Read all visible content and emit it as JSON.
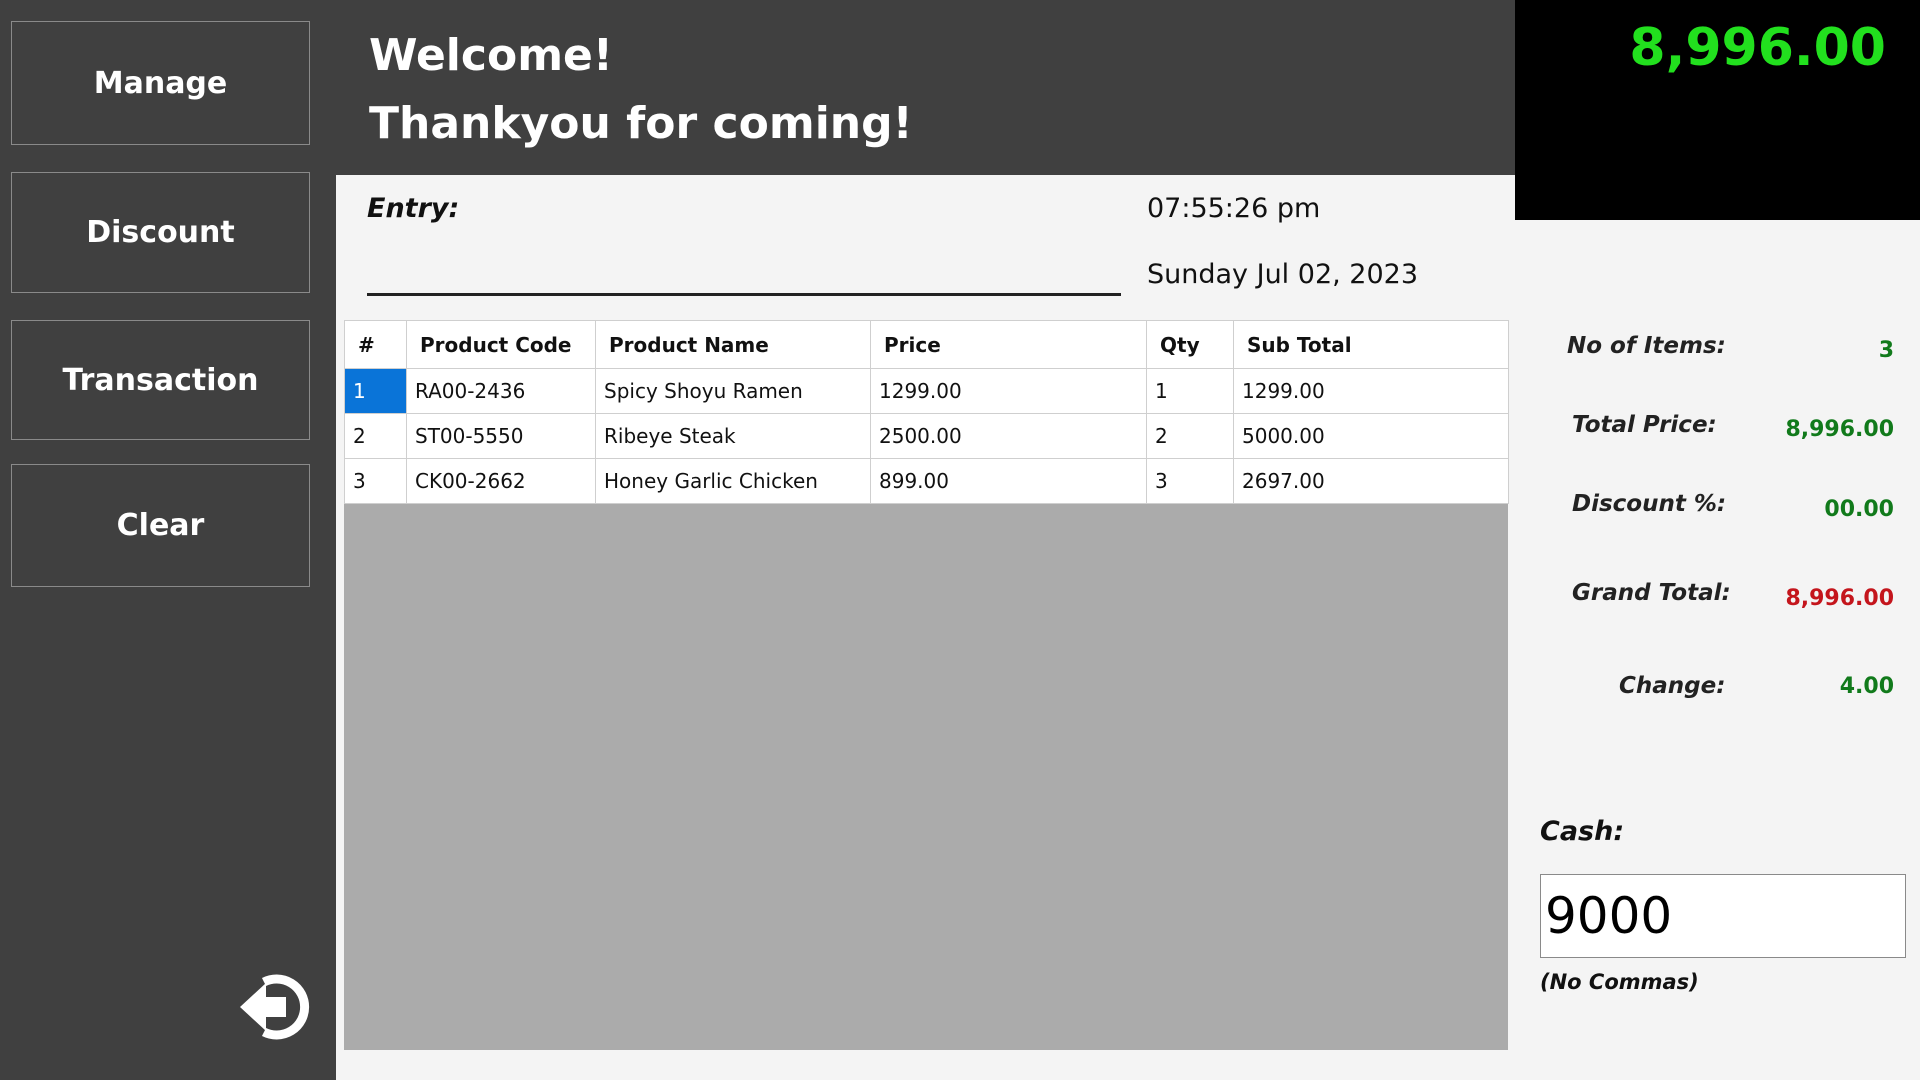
{
  "sidebar": {
    "buttons": [
      {
        "label": "Manage"
      },
      {
        "label": "Discount"
      },
      {
        "label": "Transaction"
      },
      {
        "label": "Clear"
      }
    ],
    "logout_icon": "logout-arrow-icon"
  },
  "header": {
    "line1": "Welcome!",
    "line2": "Thankyou for coming!"
  },
  "display": {
    "amount": "8,996.00",
    "color": "#22e01e"
  },
  "entry": {
    "label": "Entry:",
    "value": ""
  },
  "clock": {
    "time": "07:55:26 pm",
    "date": "Sunday Jul 02, 2023"
  },
  "table": {
    "headers": [
      "#",
      "Product Code",
      "Product Name",
      "Price",
      "Qty",
      "Sub Total"
    ],
    "rows": [
      [
        "1",
        "RA00-2436",
        "Spicy Shoyu Ramen",
        "1299.00",
        "1",
        "1299.00"
      ],
      [
        "2",
        "ST00-5550",
        "Ribeye Steak",
        "2500.00",
        "2",
        "5000.00"
      ],
      [
        "3",
        "CK00-2662",
        "Honey Garlic Chicken",
        "899.00",
        "3",
        "2697.00"
      ]
    ],
    "selected_color": "#0a74d8"
  },
  "summary": {
    "items_label": "No of Items:",
    "items_value": "3",
    "total_label": "Total Price:",
    "total_value": "8,996.00",
    "discount_label": "Discount %:",
    "discount_value": "00.00",
    "grand_label": "Grand Total:",
    "grand_value": "8,996.00",
    "change_label": "Change:",
    "change_value": "4.00",
    "value_color": "#117a1b",
    "grand_color": "#c4151c"
  },
  "cash": {
    "label": "Cash:",
    "value": "9000",
    "hint": "(No Commas)"
  }
}
